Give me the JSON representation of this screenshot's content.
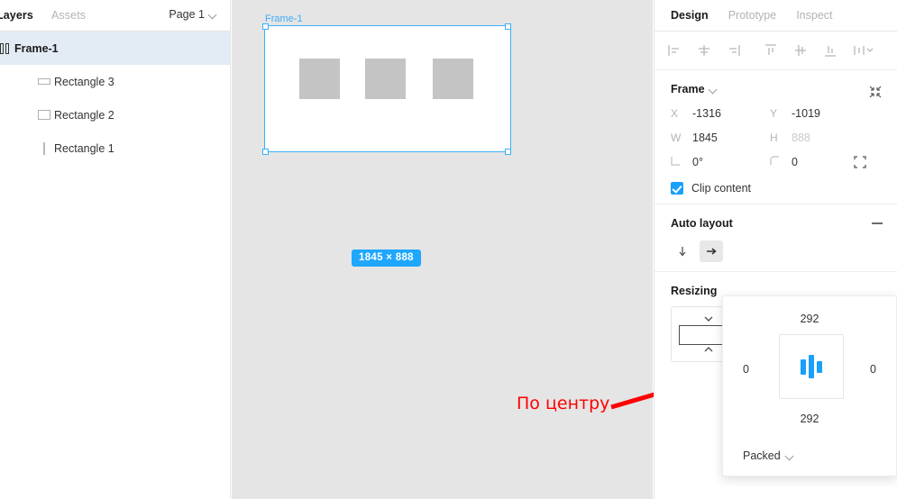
{
  "left_panel": {
    "tabs": {
      "layers": "Layers",
      "assets": "Assets"
    },
    "page_selector": {
      "label": "Page 1",
      "icon": "chevron-down-icon"
    },
    "layers": [
      {
        "name": "Frame-1",
        "icon": "frame-icon",
        "selected": true,
        "depth": 0
      },
      {
        "name": "Rectangle 3",
        "icon": "rectangle-wide-icon",
        "selected": false,
        "depth": 1
      },
      {
        "name": "Rectangle 2",
        "icon": "rectangle-icon",
        "selected": false,
        "depth": 1
      },
      {
        "name": "Rectangle 1",
        "icon": "rectangle-thin-icon",
        "selected": false,
        "depth": 1
      }
    ]
  },
  "canvas": {
    "frame_label": "Frame-1",
    "dimension_badge": "1845 × 888",
    "selection_color": "#39b0fb",
    "rect_fill": "#c4c4c4",
    "background": "#e5e5e5",
    "children_count": 3
  },
  "annotation": {
    "text": "По центру",
    "color": "#ff0000"
  },
  "right_panel": {
    "tabs": [
      {
        "label": "Design",
        "active": true
      },
      {
        "label": "Prototype",
        "active": false
      },
      {
        "label": "Inspect",
        "active": false
      }
    ],
    "align_buttons": [
      {
        "name": "align-left-icon"
      },
      {
        "name": "align-horizontal-center-icon"
      },
      {
        "name": "align-right-icon"
      },
      {
        "name": "align-top-icon"
      },
      {
        "name": "align-vertical-center-icon"
      },
      {
        "name": "align-bottom-icon"
      },
      {
        "name": "distribute-more-icon"
      }
    ],
    "frame_section": {
      "title": "Frame",
      "title_chevron": "chevron-down-icon",
      "collapse_icon": "collapse-arrows-icon",
      "x_key": "X",
      "x_value": "-1316",
      "y_key": "Y",
      "y_value": "-1019",
      "w_key": "W",
      "w_value": "1845",
      "h_key": "H",
      "h_value": "888",
      "rotation_key": "rotation-icon",
      "rotation_value": "0°",
      "corner_key": "corner-radius-icon",
      "corner_value": "0",
      "independent_corners_icon": "independent-corners-icon",
      "clip_content_label": "Clip content",
      "clip_content_checked": true
    },
    "auto_layout": {
      "title": "Auto layout",
      "remove_icon": "minus-icon",
      "direction_vertical_icon": "arrow-down-icon",
      "direction_horizontal_icon": "arrow-right-icon",
      "direction_active": "horizontal"
    },
    "resizing": {
      "title": "Resizing",
      "stepper_up_icon": "chevron-up-icon",
      "stepper_down_icon": "chevron-down-icon",
      "stepper_value": ""
    }
  },
  "align_popup": {
    "padding_top": "292",
    "padding_bottom": "292",
    "padding_left": "0",
    "padding_right": "0",
    "alignment_icon": "align-center-bars-icon",
    "alignment_color": "#18a0fb",
    "spacing_mode": "Packed",
    "spacing_mode_chevron": "chevron-down-icon"
  }
}
